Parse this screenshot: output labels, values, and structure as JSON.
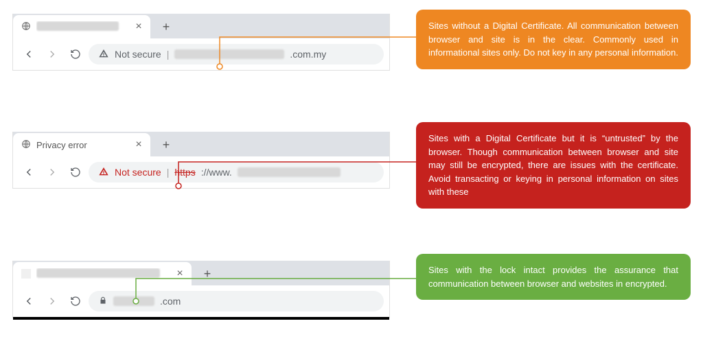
{
  "rows": [
    {
      "id": "insecure",
      "tab_title_visible": false,
      "tab_shows_globe": true,
      "not_secure_label": "Not secure",
      "not_secure_red": false,
      "url_suffix": ".com.my",
      "callout_text": "Sites without a Digital Certificate. All communication between browser and site is in the clear. Commonly used in informational sites only. Do not key in any personal information.",
      "callout_color": "orange",
      "connector_color": "#ee8722"
    },
    {
      "id": "untrusted",
      "tab_title_visible": true,
      "tab_title": "Privacy error",
      "tab_shows_globe": true,
      "not_secure_label": "Not secure",
      "not_secure_red": true,
      "https_strike": "https",
      "url_prefix": "://www.",
      "callout_text": "Sites with a Digital Certificate but it is “untrusted” by the browser. Though communication between browser and site may still be encrypted, there are issues with the certificate. Avoid transacting or keying in personal information on sites with these",
      "callout_color": "red",
      "connector_color": "#c5221e"
    },
    {
      "id": "secure",
      "tab_title_visible": false,
      "tab_shows_globe": false,
      "lock_icon": true,
      "url_suffix": ".com",
      "callout_text": "Sites with the lock intact provides the assurance that communication between browser and websites in encrypted.",
      "callout_color": "green",
      "connector_color": "#6aae42",
      "bottom_line": true
    }
  ],
  "ui": {
    "newtab_glyph": "+",
    "close_glyph": "×"
  }
}
